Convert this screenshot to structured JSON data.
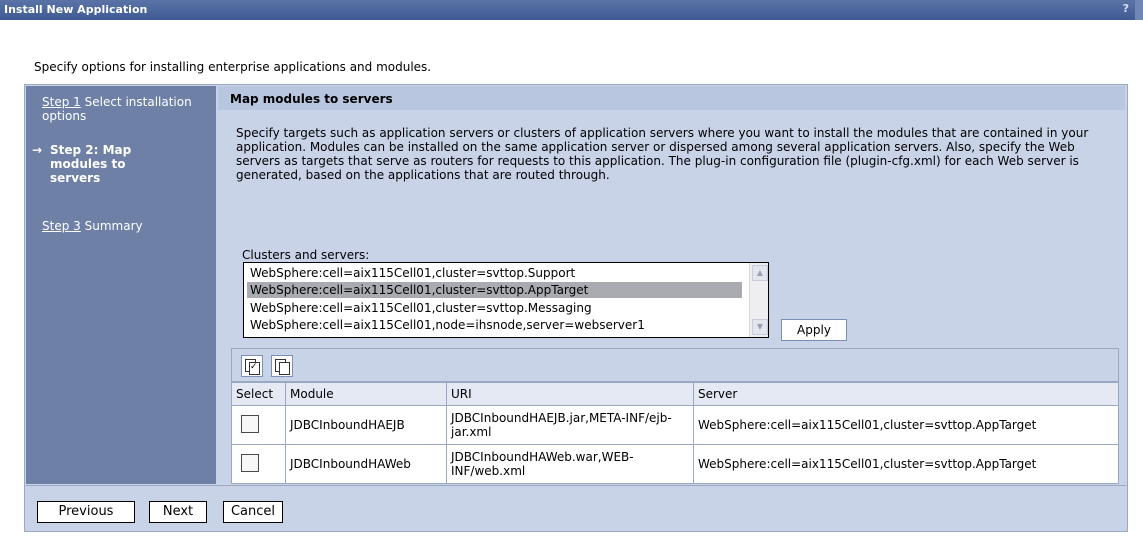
{
  "window": {
    "title": "Install New Application",
    "help": "?"
  },
  "intro": "Specify options for installing enterprise applications and modules.",
  "steps": {
    "step1": {
      "link": "Step 1",
      "text": "Select installation options"
    },
    "step2": {
      "arrow": "→",
      "text": "Step 2: Map modules to servers"
    },
    "step3": {
      "link": "Step 3",
      "text": "Summary"
    }
  },
  "panel": {
    "title": "Map modules to servers",
    "description": "Specify targets such as application servers or clusters of application servers where you want to install the modules that are contained in your application. Modules can be installed on the same application server or dispersed among several application servers. Also, specify the Web servers as targets that serve as routers for requests to this application. The plug-in configuration file (plugin-cfg.xml) for each Web server is generated, based on the applications that are routed through.",
    "clusters_label": "Clusters and servers:",
    "clusters": [
      "WebSphere:cell=aix115Cell01,cluster=svttop.Support",
      "WebSphere:cell=aix115Cell01,cluster=svttop.AppTarget",
      "WebSphere:cell=aix115Cell01,cluster=svttop.Messaging",
      "WebSphere:cell=aix115Cell01,node=ihsnode,server=webserver1"
    ],
    "apply_label": "Apply"
  },
  "table": {
    "toolbar": [
      "select-all-icon",
      "deselect-all-icon"
    ],
    "headers": {
      "select": "Select",
      "module": "Module",
      "uri": "URI",
      "server": "Server"
    },
    "rows": [
      {
        "module": "JDBCInboundHAEJB",
        "uri": "JDBCInboundHAEJB.jar,META-INF/ejb-jar.xml",
        "server": "WebSphere:cell=aix115Cell01,cluster=svttop.AppTarget"
      },
      {
        "module": "JDBCInboundHAWeb",
        "uri": "JDBCInboundHAWeb.war,WEB-INF/web.xml",
        "server": "WebSphere:cell=aix115Cell01,cluster=svttop.AppTarget"
      }
    ]
  },
  "footer": {
    "previous": "Previous",
    "next": "Next",
    "cancel": "Cancel"
  }
}
